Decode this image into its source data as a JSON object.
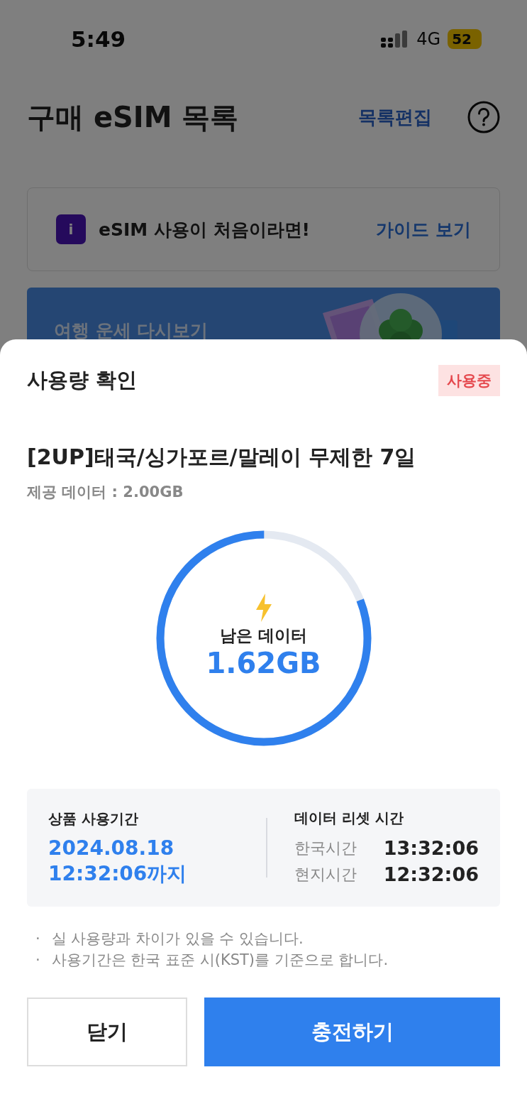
{
  "status_bar": {
    "time": "5:49",
    "network": "4G",
    "battery": "52"
  },
  "header": {
    "title": "구매 eSIM 목록",
    "edit_link": "목록편집"
  },
  "guide_card": {
    "icon": "i",
    "text": "eSIM 사용이 처음이라면!",
    "link": "가이드 보기"
  },
  "banner": {
    "text": "여행 운세 다시보기",
    "kind": "picture"
  },
  "sheet": {
    "title": "사용량 확인",
    "status": "사용중",
    "plan": "[2UP]태국/싱가포르/말레이 무제한 7일",
    "provided": "제공 데이터 : 2.00GB",
    "gauge": {
      "label": "남은 데이터",
      "value": "1.62GB",
      "level": 0.81
    },
    "period": {
      "label": "상품 사용기간",
      "date": "2024.08.18",
      "time": "12:32:06까지"
    },
    "reset": {
      "label": "데이터 리셋 시간",
      "rows": [
        {
          "name": "한국시간",
          "time": "13:32:06"
        },
        {
          "name": "현지시간",
          "time": "12:32:06"
        }
      ]
    },
    "notes": [
      {
        "bullet": "·",
        "text": "실 사용량과 차이가 있을 수 있습니다."
      },
      {
        "bullet": "·",
        "text": "사용기간은 한국 표준 시(KST)를 기준으로 합니다."
      }
    ],
    "buttons": [
      {
        "label": "닫기",
        "kind": "secondary"
      },
      {
        "label": "충전하기",
        "kind": "primary"
      }
    ]
  }
}
